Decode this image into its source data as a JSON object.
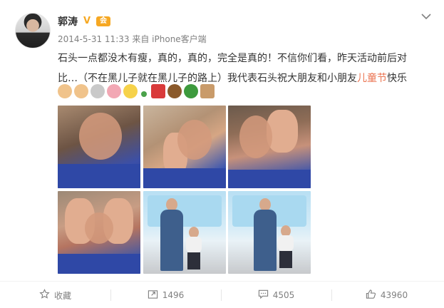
{
  "post": {
    "username": "郭涛",
    "verified_badge": "V",
    "vip_label": "会",
    "timestamp": "2014-5-31 11:33",
    "source_prefix": "来自",
    "source": "iPhone客户端",
    "text_line1": "石头一点都没木有瘦，真的，真的，完全是真的！不信你们看，昨天活动前后对",
    "text_line2_before": "比…（不在黑儿子就在黑儿子的路上）我代表石头祝大朋友和小朋友",
    "text_line2_highlight": "儿童节",
    "text_line2_after": "快乐",
    "emojis": [
      "victory-hand-icon",
      "ok-hand-icon",
      "baby-face-icon",
      "pig-face-icon",
      "sun-face-icon",
      "clover-icon",
      "red-envelope-icon",
      "cake-icon",
      "watermelon-icon",
      "ice-cream-icon"
    ],
    "photos": [
      "photo-1",
      "photo-2",
      "photo-3",
      "photo-4",
      "photo-5",
      "photo-6"
    ]
  },
  "actions": {
    "favorite_label": "收藏",
    "repost_count": "1496",
    "comment_count": "4505",
    "like_count": "43960"
  },
  "colors": {
    "accent": "#eb7350",
    "vip": "#f6a823",
    "meta_text": "#808080"
  }
}
